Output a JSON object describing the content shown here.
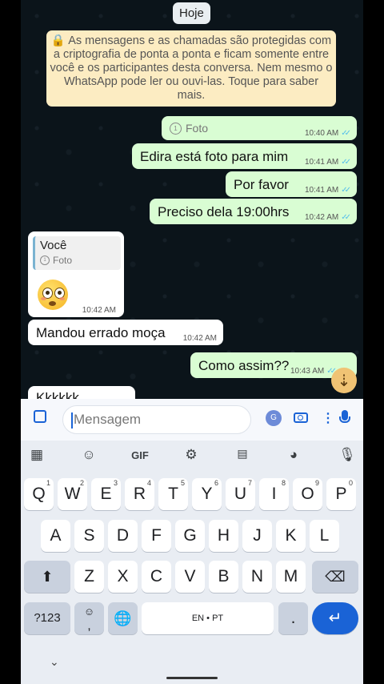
{
  "chat": {
    "date_label": "Hoje",
    "encryption_notice": "🔒 As mensagens e as chamadas são protegidas com a criptografia de ponta a ponta e ficam somente entre você e os participantes desta conversa. Nem mesmo o WhatsApp pode ler ou ouvi-las. Toque para saber mais.",
    "messages": [
      {
        "direction": "out",
        "type": "photo",
        "text": "Foto",
        "time": "10:40 AM"
      },
      {
        "direction": "out",
        "text": "Edira está foto para mim",
        "time": "10:41 AM"
      },
      {
        "direction": "out",
        "text": "Por favor",
        "time": "10:41 AM"
      },
      {
        "direction": "out",
        "text": "Preciso dela 19:00hrs",
        "time": "10:42 AM"
      },
      {
        "direction": "in",
        "type": "reply",
        "quote_author": "Você",
        "quote_text": "Foto",
        "emoji": "flushed-face",
        "time": "10:42 AM"
      },
      {
        "direction": "in",
        "text": "Mandou errado moça",
        "time": "10:42 AM"
      },
      {
        "direction": "out",
        "text": "Como assim??",
        "time": "10:43 AM"
      },
      {
        "direction": "in",
        "text": "Kkkkkk",
        "time": ""
      }
    ],
    "scroll_fab_icon": "scroll-down-icon"
  },
  "input": {
    "placeholder": "Mensagem"
  },
  "keyboard": {
    "toolbar_gif": "GIF",
    "row1": [
      [
        "Q",
        "1"
      ],
      [
        "W",
        "2"
      ],
      [
        "E",
        "3"
      ],
      [
        "R",
        "4"
      ],
      [
        "T",
        "5"
      ],
      [
        "Y",
        "6"
      ],
      [
        "U",
        "7"
      ],
      [
        "I",
        "8"
      ],
      [
        "O",
        "9"
      ],
      [
        "P",
        "0"
      ]
    ],
    "row2": [
      "A",
      "S",
      "D",
      "F",
      "G",
      "H",
      "J",
      "K",
      "L"
    ],
    "row3": [
      "Z",
      "X",
      "C",
      "V",
      "B",
      "N",
      "M"
    ],
    "sym_key": "?123",
    "emoji_key": "☺",
    "comma": ",",
    "space_label": "EN • PT",
    "period": ".",
    "colors": {
      "accent": "#1a63d6",
      "out_bubble": "#d9fdd3",
      "chat_bg": "#0b141a",
      "notice_bg": "#fcecc2"
    }
  }
}
